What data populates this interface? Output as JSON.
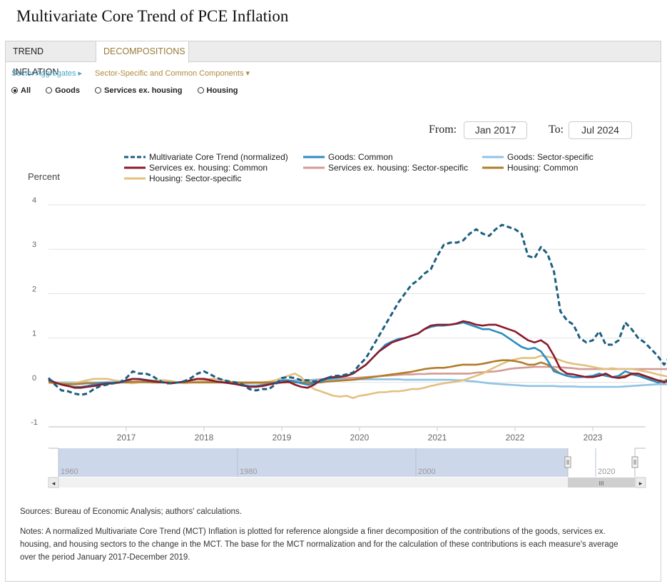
{
  "page_title": "Multivariate Core Trend of PCE Inflation",
  "tabs": [
    {
      "label": "TREND INFLATION",
      "active": false
    },
    {
      "label": "DECOMPOSITIONS",
      "active": true
    }
  ],
  "subnav": [
    {
      "label": "Sector Aggregates ▸",
      "active": false
    },
    {
      "label": "Sector-Specific and Common Components ▾",
      "active": true
    }
  ],
  "radios": [
    {
      "label": "All",
      "selected": true
    },
    {
      "label": "Goods",
      "selected": false
    },
    {
      "label": "Services ex. housing",
      "selected": false
    },
    {
      "label": "Housing",
      "selected": false
    }
  ],
  "range": {
    "from_label": "From:",
    "from_value": "Jan 2017",
    "to_label": "To:",
    "to_value": "Jul 2024"
  },
  "navigator": {
    "labels": [
      "1960",
      "1980",
      "2000",
      "2020"
    ],
    "scroll_grip": "III"
  },
  "footer": {
    "sources": "Sources: Bureau of Economic Analysis; authors' calculations.",
    "notes": "Notes: A normalized Multivariate Core Trend (MCT) Inflation is plotted for reference alongside a finer decomposition of the contributions of the goods, services ex. housing, and housing sectors to the change in the MCT. The base for the MCT normalization and for the calculation of these contributions is each measure's average over the period January 2017-December 2019."
  },
  "chart_data": {
    "type": "line",
    "title": "",
    "xlabel": "",
    "ylabel": "Percent",
    "x_start": "2016-01",
    "x_frequency": "monthly",
    "x_ticks": [
      "2017",
      "2018",
      "2019",
      "2020",
      "2021",
      "2022",
      "2023"
    ],
    "y_ticks": [
      -1,
      0,
      1,
      2,
      3,
      4
    ],
    "ylim": [
      -1,
      4
    ],
    "grid": true,
    "legend_position": "top",
    "series": [
      {
        "name": "Multivariate Core Trend (normalized)",
        "color": "#1b5e80",
        "dash": true,
        "values": [
          0.1,
          -0.05,
          -0.18,
          -0.2,
          -0.25,
          -0.28,
          -0.25,
          -0.15,
          -0.08,
          -0.05,
          -0.02,
          0.0,
          0.1,
          0.25,
          0.2,
          0.2,
          0.15,
          0.05,
          -0.02,
          -0.02,
          0.0,
          0.03,
          0.1,
          0.2,
          0.25,
          0.18,
          0.1,
          0.05,
          0.02,
          0.0,
          -0.05,
          -0.15,
          -0.18,
          -0.15,
          -0.15,
          -0.05,
          0.1,
          0.12,
          0.1,
          0.05,
          0.05,
          0.02,
          0.05,
          0.1,
          0.15,
          0.15,
          0.18,
          0.22,
          0.4,
          0.55,
          0.8,
          1.05,
          1.3,
          1.55,
          1.8,
          2.0,
          2.2,
          2.3,
          2.45,
          2.55,
          2.85,
          3.1,
          3.15,
          3.15,
          3.2,
          3.35,
          3.45,
          3.35,
          3.3,
          3.45,
          3.55,
          3.5,
          3.45,
          3.35,
          2.85,
          2.8,
          3.05,
          2.9,
          2.5,
          1.6,
          1.4,
          1.3,
          1.0,
          0.9,
          0.95,
          1.15,
          0.85,
          0.85,
          0.95,
          1.35,
          1.2,
          1.0,
          0.9,
          0.75,
          0.6,
          0.4,
          0.6
        ]
      },
      {
        "name": "Goods: Common",
        "color": "#2b8cc4",
        "dash": false,
        "values": [
          0.08,
          0.0,
          -0.05,
          -0.08,
          -0.1,
          -0.1,
          -0.08,
          -0.05,
          -0.02,
          0.0,
          0.0,
          0.0,
          0.03,
          0.08,
          0.08,
          0.06,
          0.04,
          0.02,
          0.0,
          -0.02,
          0.0,
          0.02,
          0.05,
          0.08,
          0.08,
          0.05,
          0.02,
          0.0,
          -0.02,
          -0.04,
          -0.06,
          -0.08,
          -0.08,
          -0.06,
          -0.04,
          0.0,
          0.05,
          0.05,
          0.02,
          -0.02,
          -0.05,
          -0.02,
          0.02,
          0.08,
          0.1,
          0.12,
          0.15,
          0.2,
          0.3,
          0.4,
          0.55,
          0.7,
          0.85,
          0.92,
          0.98,
          1.0,
          1.05,
          1.1,
          1.2,
          1.25,
          1.28,
          1.28,
          1.3,
          1.32,
          1.35,
          1.3,
          1.25,
          1.2,
          1.2,
          1.15,
          1.1,
          1.0,
          0.9,
          0.8,
          0.75,
          0.78,
          0.7,
          0.5,
          0.25,
          0.2,
          0.15,
          0.12,
          0.12,
          0.13,
          0.15,
          0.2,
          0.15,
          0.12,
          0.15,
          0.25,
          0.2,
          0.15,
          0.1,
          0.05,
          0.0,
          0.02,
          0.08
        ]
      },
      {
        "name": "Goods: Sector-specific",
        "color": "#8fc3e3",
        "dash": false,
        "values": [
          0.0,
          0.0,
          0.0,
          0.0,
          0.0,
          0.0,
          0.0,
          0.0,
          0.0,
          0.0,
          0.0,
          0.0,
          0.0,
          0.0,
          0.0,
          0.0,
          0.0,
          0.0,
          0.0,
          0.0,
          0.0,
          0.0,
          0.0,
          0.0,
          0.0,
          0.0,
          0.0,
          0.0,
          0.0,
          0.0,
          0.0,
          0.0,
          0.0,
          0.0,
          0.0,
          0.0,
          0.02,
          0.03,
          0.04,
          0.05,
          0.05,
          0.05,
          0.05,
          0.05,
          0.05,
          0.06,
          0.06,
          0.06,
          0.07,
          0.07,
          0.07,
          0.07,
          0.07,
          0.07,
          0.07,
          0.06,
          0.06,
          0.06,
          0.06,
          0.06,
          0.06,
          0.06,
          0.06,
          0.05,
          0.05,
          0.03,
          0.02,
          0.0,
          -0.02,
          -0.03,
          -0.04,
          -0.05,
          -0.06,
          -0.07,
          -0.08,
          -0.08,
          -0.08,
          -0.08,
          -0.08,
          -0.09,
          -0.09,
          -0.09,
          -0.1,
          -0.1,
          -0.1,
          -0.1,
          -0.1,
          -0.1,
          -0.1,
          -0.09,
          -0.08,
          -0.07,
          -0.06,
          -0.05,
          -0.04,
          -0.04,
          -0.04
        ]
      },
      {
        "name": "Services ex. housing: Common",
        "color": "#8b1a2b",
        "dash": false,
        "values": [
          0.05,
          0.0,
          -0.05,
          -0.08,
          -0.12,
          -0.12,
          -0.1,
          -0.08,
          -0.05,
          -0.03,
          -0.02,
          0.0,
          0.05,
          0.08,
          0.07,
          0.05,
          0.03,
          0.01,
          0.0,
          -0.02,
          0.0,
          0.02,
          0.05,
          0.08,
          0.08,
          0.05,
          0.02,
          0.0,
          -0.02,
          -0.04,
          -0.07,
          -0.1,
          -0.1,
          -0.08,
          -0.05,
          -0.02,
          0.0,
          0.02,
          -0.05,
          -0.1,
          -0.12,
          -0.05,
          0.05,
          0.1,
          0.12,
          0.13,
          0.15,
          0.2,
          0.3,
          0.4,
          0.55,
          0.7,
          0.8,
          0.9,
          0.95,
          1.0,
          1.05,
          1.1,
          1.2,
          1.28,
          1.3,
          1.3,
          1.3,
          1.33,
          1.38,
          1.35,
          1.3,
          1.28,
          1.3,
          1.3,
          1.25,
          1.2,
          1.15,
          1.05,
          0.95,
          0.9,
          0.95,
          0.85,
          0.6,
          0.3,
          0.2,
          0.18,
          0.15,
          0.12,
          0.12,
          0.15,
          0.2,
          0.12,
          0.1,
          0.12,
          0.2,
          0.2,
          0.15,
          0.1,
          0.05,
          0.0,
          0.05
        ]
      },
      {
        "name": "Services ex. housing: Sector-specific",
        "color": "#d49a94",
        "dash": false,
        "values": [
          0.0,
          0.0,
          0.0,
          -0.02,
          -0.02,
          -0.02,
          0.0,
          0.0,
          0.0,
          0.0,
          0.0,
          0.0,
          0.02,
          0.02,
          0.02,
          0.02,
          0.0,
          0.0,
          0.0,
          0.0,
          0.0,
          0.0,
          0.0,
          0.02,
          0.02,
          0.02,
          0.02,
          0.0,
          0.0,
          0.0,
          -0.02,
          -0.02,
          -0.02,
          -0.02,
          0.0,
          0.0,
          0.02,
          0.03,
          0.05,
          0.05,
          0.05,
          0.06,
          0.07,
          0.08,
          0.08,
          0.09,
          0.1,
          0.1,
          0.11,
          0.12,
          0.13,
          0.14,
          0.15,
          0.16,
          0.17,
          0.18,
          0.18,
          0.19,
          0.19,
          0.2,
          0.2,
          0.2,
          0.2,
          0.2,
          0.2,
          0.2,
          0.22,
          0.23,
          0.24,
          0.25,
          0.27,
          0.3,
          0.32,
          0.33,
          0.34,
          0.35,
          0.35,
          0.35,
          0.35,
          0.34,
          0.33,
          0.32,
          0.3,
          0.3,
          0.3,
          0.3,
          0.3,
          0.3,
          0.3,
          0.3,
          0.3,
          0.3,
          0.3,
          0.3,
          0.3,
          0.3,
          0.3
        ]
      },
      {
        "name": "Housing: Common",
        "color": "#b07d2b",
        "dash": false,
        "values": [
          0.0,
          -0.02,
          -0.03,
          -0.04,
          -0.04,
          -0.03,
          -0.02,
          -0.02,
          -0.01,
          0.0,
          0.0,
          0.0,
          0.0,
          0.01,
          0.01,
          0.01,
          0.0,
          0.0,
          0.0,
          0.0,
          0.0,
          0.0,
          0.0,
          0.0,
          0.0,
          0.0,
          0.0,
          0.0,
          0.0,
          0.0,
          0.0,
          0.0,
          0.0,
          0.0,
          0.0,
          0.0,
          0.0,
          0.0,
          0.0,
          0.0,
          0.0,
          0.0,
          0.0,
          0.02,
          0.03,
          0.04,
          0.05,
          0.06,
          0.08,
          0.1,
          0.12,
          0.14,
          0.16,
          0.18,
          0.2,
          0.22,
          0.24,
          0.27,
          0.3,
          0.32,
          0.33,
          0.33,
          0.35,
          0.38,
          0.4,
          0.4,
          0.4,
          0.42,
          0.45,
          0.48,
          0.5,
          0.5,
          0.48,
          0.45,
          0.4,
          0.4,
          0.45,
          0.4,
          0.3,
          0.2,
          0.15,
          0.12,
          0.12,
          0.13,
          0.15,
          0.18,
          0.15,
          0.12,
          0.12,
          0.15,
          0.18,
          0.15,
          0.12,
          0.08,
          0.05,
          0.03,
          0.1
        ]
      },
      {
        "name": "Housing: Sector-specific",
        "color": "#e3c07e",
        "dash": false,
        "values": [
          0.02,
          0.0,
          -0.02,
          -0.03,
          -0.02,
          0.02,
          0.05,
          0.08,
          0.08,
          0.08,
          0.05,
          0.03,
          0.0,
          -0.02,
          0.0,
          0.02,
          0.03,
          0.05,
          0.05,
          0.03,
          0.0,
          -0.02,
          0.0,
          0.02,
          0.05,
          0.08,
          0.08,
          0.05,
          0.02,
          0.0,
          0.0,
          0.0,
          -0.02,
          0.0,
          0.02,
          0.05,
          0.1,
          0.15,
          0.2,
          0.12,
          -0.05,
          -0.15,
          -0.2,
          -0.25,
          -0.3,
          -0.32,
          -0.3,
          -0.35,
          -0.3,
          -0.28,
          -0.25,
          -0.22,
          -0.22,
          -0.2,
          -0.2,
          -0.18,
          -0.15,
          -0.15,
          -0.12,
          -0.08,
          -0.05,
          -0.02,
          0.0,
          0.02,
          0.05,
          0.1,
          0.15,
          0.2,
          0.28,
          0.35,
          0.42,
          0.48,
          0.52,
          0.55,
          0.55,
          0.55,
          0.6,
          0.58,
          0.55,
          0.5,
          0.45,
          0.42,
          0.4,
          0.38,
          0.35,
          0.32,
          0.3,
          0.32,
          0.3,
          0.3,
          0.3,
          0.28,
          0.25,
          0.22,
          0.18,
          0.15,
          0.12
        ]
      }
    ]
  }
}
